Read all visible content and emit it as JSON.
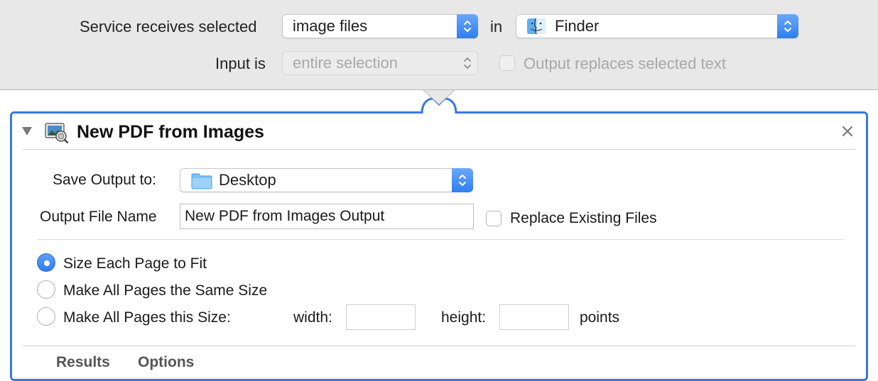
{
  "service": {
    "receives_label": "Service receives selected",
    "receives_value": "image files",
    "in_label": "in",
    "app_value": "Finder",
    "app_icon": "finder-icon",
    "input_label": "Input is",
    "input_value": "entire selection",
    "output_replaces_label": "Output replaces selected text",
    "output_replaces_checked": false
  },
  "action": {
    "title": "New PDF from Images",
    "icon": "preview-photos-icon",
    "collapse_icon": "disclosure-triangle-icon",
    "close_icon": "close-icon",
    "save_output_label": "Save Output to:",
    "save_output_value": "Desktop",
    "save_output_icon": "folder-icon",
    "file_name_label": "Output File Name",
    "file_name_value": "New PDF from Images Output",
    "replace_existing_label": "Replace Existing Files",
    "replace_existing_checked": false,
    "sizing_options": [
      {
        "label": "Size Each Page to Fit",
        "selected": true
      },
      {
        "label": "Make All Pages the Same Size",
        "selected": false
      },
      {
        "label": "Make All Pages this Size:",
        "selected": false
      }
    ],
    "width_label": "width:",
    "width_value": "",
    "height_label": "height:",
    "height_value": "",
    "points_label": "points",
    "tabs": [
      "Results",
      "Options"
    ]
  },
  "colors": {
    "accent": "#3a78dc",
    "header_bg": "#e8e8e8",
    "popup_stepper": "#2f7ef1"
  }
}
